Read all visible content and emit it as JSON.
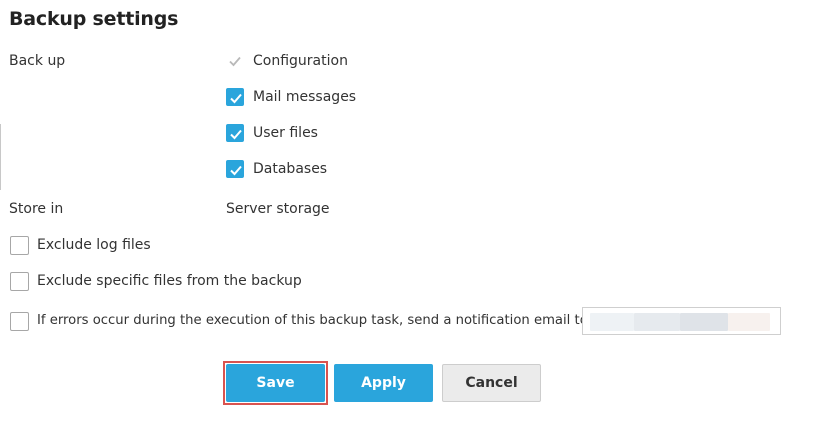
{
  "page": {
    "title": "Backup settings"
  },
  "backup": {
    "label": "Back up",
    "options": [
      {
        "label": "Configuration",
        "checked": true,
        "disabled": true
      },
      {
        "label": "Mail messages",
        "checked": true,
        "disabled": false
      },
      {
        "label": "User files",
        "checked": true,
        "disabled": false
      },
      {
        "label": "Databases",
        "checked": true,
        "disabled": false
      }
    ]
  },
  "store": {
    "label": "Store in",
    "value": "Server storage"
  },
  "exclusions": {
    "exclude_logs": {
      "label": "Exclude log files",
      "checked": false
    },
    "exclude_specific": {
      "label": "Exclude specific files from the backup",
      "checked": false
    },
    "notify_errors": {
      "label": "If errors occur during the execution of this backup task, send a notification email to",
      "checked": false
    }
  },
  "email": {
    "value": ""
  },
  "buttons": {
    "save": "Save",
    "apply": "Apply",
    "cancel": "Cancel"
  },
  "colors": {
    "accent": "#2aa5dc",
    "highlight": "#d9534f"
  },
  "icons": {
    "check": "check-icon"
  }
}
